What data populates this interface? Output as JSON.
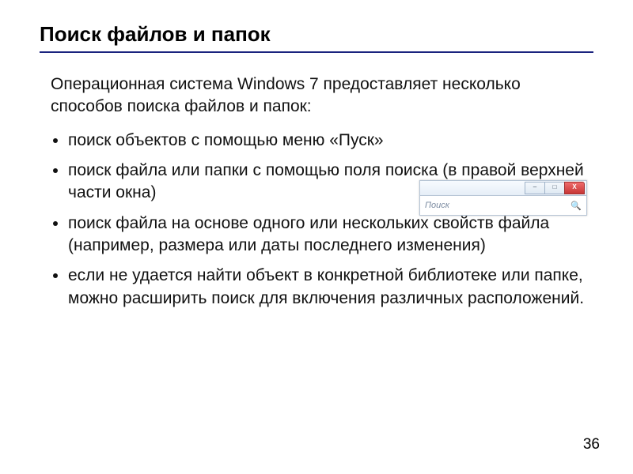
{
  "title": "Поиск файлов и папок",
  "intro": "Операционная система Windows 7 предоставляет несколько способов поиска файлов и папок:",
  "bullets1": [
    "поиск объектов с помощью меню «Пуск»",
    "поиск файла или папки с помощью поля поиска (в правой верхней части окна)"
  ],
  "bullets2": [
    "поиск файла на основе одного или нескольких свойств файла (например, размера или даты последнего изменения)",
    "если не удается найти объект в конкретной библиотеке или папке, можно расширить поиск для включения различных расположений."
  ],
  "win7": {
    "minimize": "–",
    "maximize": "□",
    "close": "X",
    "search_placeholder": "Поиск",
    "search_icon": "🔍"
  },
  "page_number": "36"
}
